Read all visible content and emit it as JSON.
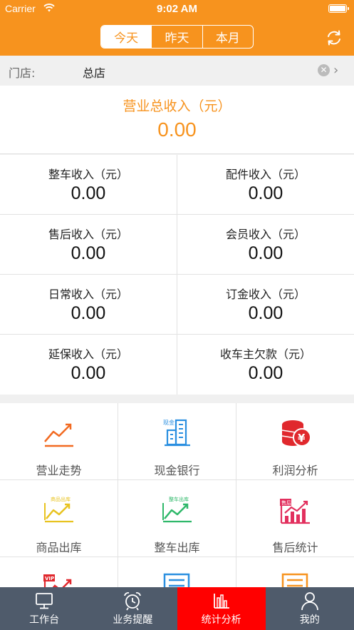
{
  "status_bar": {
    "carrier": "Carrier",
    "time": "9:02 AM"
  },
  "header": {
    "segments": [
      {
        "label": "今天",
        "active": true
      },
      {
        "label": "昨天",
        "active": false
      },
      {
        "label": "本月",
        "active": false
      }
    ],
    "refresh_icon": "refresh-icon"
  },
  "store": {
    "label": "门店:",
    "value": "总店",
    "clear_icon": "clear-icon",
    "chevron_icon": "chevron-right-icon"
  },
  "total": {
    "label": "营业总收入（元）",
    "value": "0.00"
  },
  "income_items": [
    {
      "label": "整车收入（元）",
      "value": "0.00"
    },
    {
      "label": "配件收入（元）",
      "value": "0.00"
    },
    {
      "label": "售后收入（元）",
      "value": "0.00"
    },
    {
      "label": "会员收入（元）",
      "value": "0.00"
    },
    {
      "label": "日常收入（元）",
      "value": "0.00"
    },
    {
      "label": "订金收入（元）",
      "value": "0.00"
    },
    {
      "label": "延保收入（元）",
      "value": "0.00"
    },
    {
      "label": "收车主欠款（元）",
      "value": "0.00"
    }
  ],
  "menu": [
    {
      "label": "营业走势",
      "icon": "trend-line-icon",
      "color": "#f26a21"
    },
    {
      "label": "现金银行",
      "icon": "bank-building-icon",
      "color": "#2a8fe0",
      "icon_text": "现金"
    },
    {
      "label": "利润分析",
      "icon": "coin-stack-yen-icon",
      "color": "#e0282d",
      "icon_text": "¥"
    },
    {
      "label": "商品出库",
      "icon": "goods-outbound-chart-icon",
      "color": "#e8c320",
      "icon_text": "商品出库"
    },
    {
      "label": "整车出库",
      "icon": "vehicle-outbound-chart-icon",
      "color": "#2fb86a",
      "icon_text": "整车出库"
    },
    {
      "label": "售后统计",
      "icon": "aftersales-chart-icon",
      "color": "#e2305e",
      "icon_text": "售后"
    },
    {
      "label": "",
      "icon": "vip-chart-icon",
      "color": "#e0282d",
      "icon_text": "VIP"
    },
    {
      "label": "",
      "icon": "blue-document-icon",
      "color": "#2a8fe0"
    },
    {
      "label": "",
      "icon": "orange-document-icon",
      "color": "#f7931e"
    }
  ],
  "tabs": [
    {
      "label": "工作台",
      "icon": "monitor-icon",
      "active": false
    },
    {
      "label": "业务提醒",
      "icon": "alarm-clock-icon",
      "active": false
    },
    {
      "label": "统计分析",
      "icon": "bar-chart-icon",
      "active": true
    },
    {
      "label": "我的",
      "icon": "user-icon",
      "active": false
    }
  ]
}
